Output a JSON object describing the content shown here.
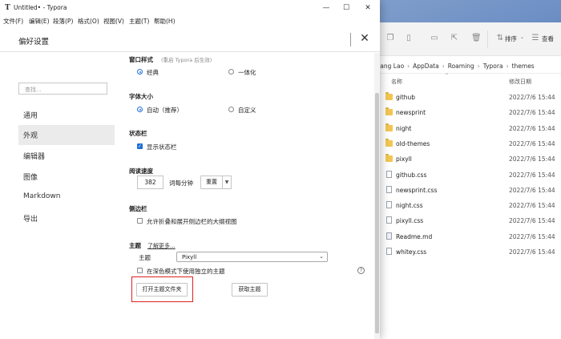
{
  "explorer": {
    "toolbar": {
      "sort_label": "排序",
      "view_label": "查看"
    },
    "breadcrumb": [
      "Jiang Lao",
      "AppData",
      "Roaming",
      "Typora",
      "themes"
    ],
    "columns": {
      "name": "名称",
      "date": "修改日期"
    },
    "rows": [
      {
        "name": "github",
        "type": "folder",
        "date": "2022/7/6 15:44"
      },
      {
        "name": "newsprint",
        "type": "folder",
        "date": "2022/7/6 15:44"
      },
      {
        "name": "night",
        "type": "folder",
        "date": "2022/7/6 15:44"
      },
      {
        "name": "old-themes",
        "type": "folder",
        "date": "2022/7/6 15:44"
      },
      {
        "name": "pixyll",
        "type": "folder",
        "date": "2022/7/6 15:44"
      },
      {
        "name": "github.css",
        "type": "file",
        "date": "2022/7/6 15:44"
      },
      {
        "name": "newsprint.css",
        "type": "file",
        "date": "2022/7/6 15:44"
      },
      {
        "name": "night.css",
        "type": "file",
        "date": "2022/7/6 15:44"
      },
      {
        "name": "pixyll.css",
        "type": "file",
        "date": "2022/7/6 15:44"
      },
      {
        "name": "Readme.md",
        "type": "md",
        "date": "2022/7/6 15:44"
      },
      {
        "name": "whitey.css",
        "type": "file",
        "date": "2022/7/6 15:44"
      }
    ]
  },
  "window": {
    "icon": "T",
    "title": "Untitled• - Typora",
    "minimize": "—",
    "maximize": "☐",
    "close": "✕"
  },
  "menu": [
    "文件(F)",
    "编辑(E)",
    "段落(P)",
    "格式(O)",
    "视图(V)",
    "主题(T)",
    "帮助(H)"
  ],
  "dialog": {
    "title": "偏好设置",
    "close": "✕"
  },
  "nav": {
    "search_placeholder": "查找...",
    "items": [
      "通用",
      "外观",
      "编辑器",
      "图像",
      "Markdown",
      "导出"
    ],
    "active_index": 1
  },
  "content": {
    "window_style": {
      "title": "窗口样式",
      "note": "(重启 Typora 后生效)",
      "options": [
        "经典",
        "一体化"
      ],
      "selected": 0
    },
    "font_size": {
      "title": "字体大小",
      "options": [
        "自动（推荐）",
        "自定义"
      ],
      "selected": 0
    },
    "status_bar": {
      "title": "状态栏",
      "checkbox_label": "显示状态栏",
      "checked": true
    },
    "reading_speed": {
      "title": "阅读速度",
      "value": "382",
      "unit": "词每分钟",
      "reset_label": "重置",
      "dropdown_icon": "▼"
    },
    "sidebar": {
      "title": "侧边栏",
      "checkbox_label": "允许折叠和展开侧边栏的大纲视图",
      "checked": false
    },
    "theme": {
      "title": "主题",
      "learn_more": "了解更多...",
      "theme_label": "主题",
      "theme_value": "Pixyll",
      "dark_checkbox_label": "在深色模式下使用独立的主题",
      "dark_checked": false,
      "help_icon": "?",
      "open_folder_label": "打开主题文件夹",
      "get_themes_label": "获取主题"
    }
  }
}
